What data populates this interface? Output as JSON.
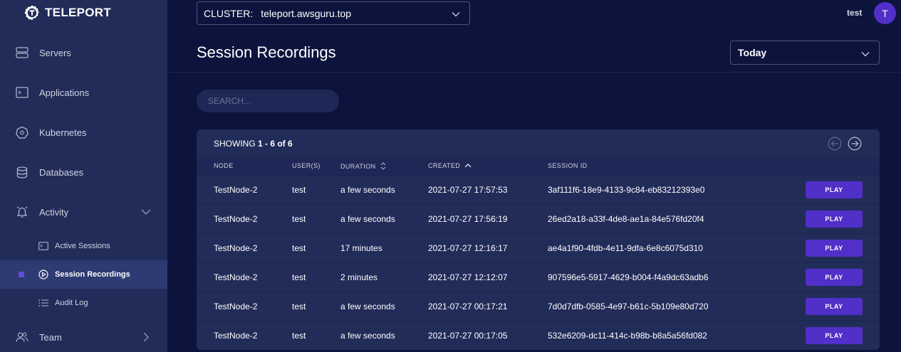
{
  "brand": {
    "name": "TELEPORT"
  },
  "sidebar": {
    "items": [
      {
        "label": "Servers",
        "icon": "server-icon"
      },
      {
        "label": "Applications",
        "icon": "application-icon"
      },
      {
        "label": "Kubernetes",
        "icon": "kubernetes-icon"
      },
      {
        "label": "Databases",
        "icon": "database-icon"
      },
      {
        "label": "Activity",
        "icon": "bell-icon",
        "expanded": true
      },
      {
        "label": "Team",
        "icon": "team-icon",
        "expanded": false
      }
    ],
    "activity_subitems": [
      {
        "label": "Active Sessions",
        "icon": "terminal-icon"
      },
      {
        "label": "Session Recordings",
        "icon": "play-circle-icon",
        "active": true
      },
      {
        "label": "Audit Log",
        "icon": "list-icon"
      }
    ]
  },
  "topbar": {
    "cluster_label": "CLUSTER:",
    "cluster_value": "teleport.awsguru.top",
    "username": "test",
    "avatar_initial": "T"
  },
  "page": {
    "title": "Session Recordings",
    "range_value": "Today",
    "search_placeholder": "SEARCH..."
  },
  "table": {
    "showing_prefix": "SHOWING ",
    "showing_range": "1 - 6",
    "showing_of": " of ",
    "showing_total": "6",
    "columns": {
      "node": "NODE",
      "users": "USER(S)",
      "duration": "DURATION",
      "created": "CREATED",
      "session_id": "SESSION ID"
    },
    "play_label": "PLAY",
    "rows": [
      {
        "node": "TestNode-2",
        "users": "test",
        "duration": "a few seconds",
        "created": "2021-07-27 17:57:53",
        "session_id": "3af111f6-18e9-4133-9c84-eb83212393e0"
      },
      {
        "node": "TestNode-2",
        "users": "test",
        "duration": "a few seconds",
        "created": "2021-07-27 17:56:19",
        "session_id": "26ed2a18-a33f-4de8-ae1a-84e576fd20f4"
      },
      {
        "node": "TestNode-2",
        "users": "test",
        "duration": "17 minutes",
        "created": "2021-07-27 12:16:17",
        "session_id": "ae4a1f90-4fdb-4e11-9dfa-6e8c6075d310"
      },
      {
        "node": "TestNode-2",
        "users": "test",
        "duration": "2 minutes",
        "created": "2021-07-27 12:12:07",
        "session_id": "907596e5-5917-4629-b004-f4a9dc63adb6"
      },
      {
        "node": "TestNode-2",
        "users": "test",
        "duration": "a few seconds",
        "created": "2021-07-27 00:17:21",
        "session_id": "7d0d7dfb-0585-4e97-b61c-5b109e80d720"
      },
      {
        "node": "TestNode-2",
        "users": "test",
        "duration": "a few seconds",
        "created": "2021-07-27 00:17:05",
        "session_id": "532e6209-dc11-414c-b98b-b8a5a56fd082"
      }
    ]
  },
  "colors": {
    "background": "#0c143d",
    "sidebar": "#222c59",
    "accent": "#512fc9",
    "active_item": "#2e3a72"
  }
}
